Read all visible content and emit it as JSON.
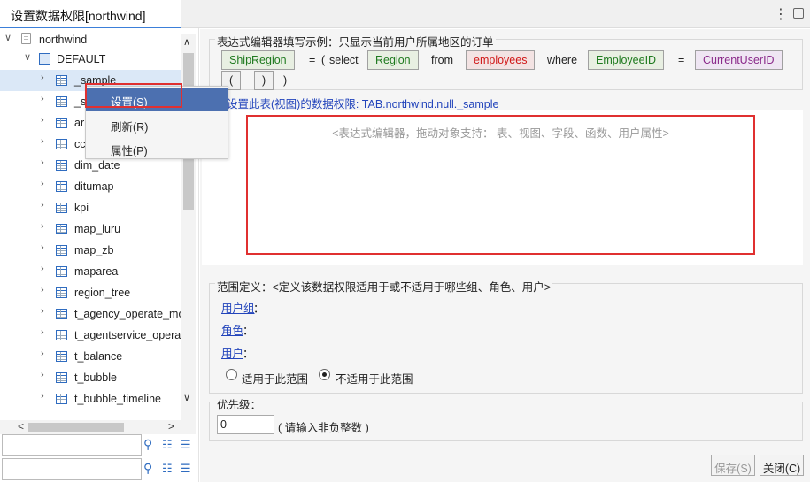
{
  "window": {
    "tab_title": "设置数据权限[northwind]"
  },
  "tree": {
    "root": "northwind",
    "schema": "DEFAULT",
    "items": [
      {
        "label": "_sample"
      },
      {
        "label": "_s"
      },
      {
        "label": "ar"
      },
      {
        "label": "cc"
      },
      {
        "label": "dim_date"
      },
      {
        "label": "ditumap"
      },
      {
        "label": "kpi"
      },
      {
        "label": "map_luru"
      },
      {
        "label": "map_zb"
      },
      {
        "label": "maparea"
      },
      {
        "label": "region_tree"
      },
      {
        "label": "t_agency_operate_mo"
      },
      {
        "label": "t_agentservice_opera"
      },
      {
        "label": "t_balance"
      },
      {
        "label": "t_bubble"
      },
      {
        "label": "t_bubble_timeline"
      }
    ]
  },
  "context_menu": {
    "items": [
      "设置(S)",
      "刷新(R)",
      "属性(P)"
    ]
  },
  "example": {
    "legend": "表达式编辑器填写示例：只显示当前用户所属地区的订单",
    "tokens": [
      "ShipRegion",
      "=",
      "(",
      "select",
      "Region",
      "from",
      "employees",
      "where",
      "EmployeeID",
      "=",
      "CurrentUserID"
    ],
    "paren_open": "(",
    "paren_close": ")",
    "paren_tail": ")"
  },
  "set_label": "设置此表(视图)的数据权限: TAB.northwind.null._sample",
  "expression": {
    "placeholder": "<表达式编辑器，拖动对象支持： 表、视图、字段、函数、用户属性>"
  },
  "scope": {
    "legend": "范围定义：<定义该数据权限适用于或不适用于哪些组、角色、用户>",
    "group": "用户组",
    "role": "角色",
    "user": "用户",
    "colon": "：",
    "apply": "适用于此范围",
    "not_apply": "不适用于此范围",
    "selected": "not_apply"
  },
  "priority": {
    "legend": "优先级：",
    "value": "0",
    "hint": "( 请输入非负整数 )"
  },
  "buttons": {
    "save": "保存(S)",
    "close": "关闭(C)"
  },
  "colors": {
    "accent": "#3b7fd9",
    "highlight": "#e03030",
    "menu_selected": "#4c70b0"
  }
}
